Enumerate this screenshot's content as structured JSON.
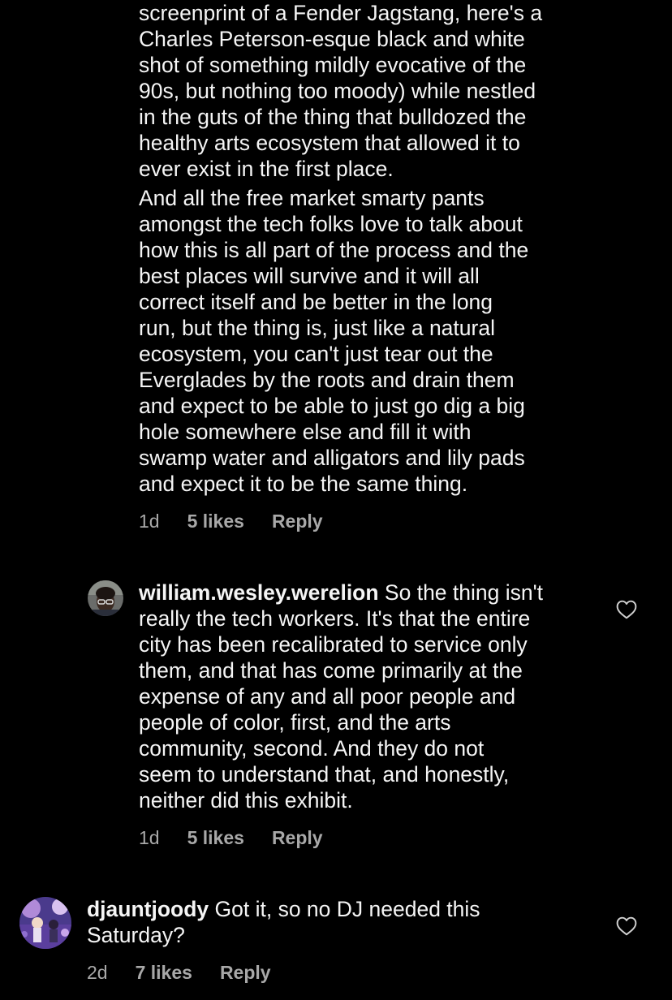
{
  "comment_continued": {
    "paragraph_1": "screenprint of a Fender Jagstang, here's a\nCharles Peterson-esque black and white\nshot of something mildly evocative of the\n90s, but nothing too moody) while nestled\nin the guts of the thing that bulldozed the\nhealthy arts ecosystem that allowed it to\never exist in the first place.",
    "paragraph_2": "And all the free market smarty pants\namongst the tech folks love to talk about\nhow this is all part of the process and the\nbest places will survive and it will all\ncorrect itself and be better in the long\nrun, but the thing is, just like a natural\necosystem, you can't just tear out the\nEverglades by the roots and drain them\nand expect to be able to just go dig a big\nhole somewhere else and fill it with\nswamp water and alligators and lily pads\nand expect it to be the same thing.",
    "time": "1d",
    "likes": "5 likes",
    "reply": "Reply"
  },
  "comment_william": {
    "username": "william.wesley.werelion",
    "text": " So the thing isn't\nreally the tech workers. It's that the entire\ncity has been recalibrated to service only\nthem, and that has come primarily at the\nexpense of any and all poor people and\npeople of color, first, and the arts\ncommunity, second. And they do not\nseem to understand that, and honestly,\nneither did this exhibit.",
    "time": "1d",
    "likes": "5 likes",
    "reply": "Reply"
  },
  "comment_djauntjoody": {
    "username": "djauntjoody",
    "text": " Got it, so no DJ needed this\nSaturday?",
    "time": "2d",
    "likes": "7 likes",
    "reply": "Reply"
  },
  "icons": {
    "like": "heart-outline-icon",
    "avatar": "profile-avatar"
  },
  "colors": {
    "background": "#000000",
    "text": "#f5f5f5",
    "secondary": "#a8a8a8"
  }
}
